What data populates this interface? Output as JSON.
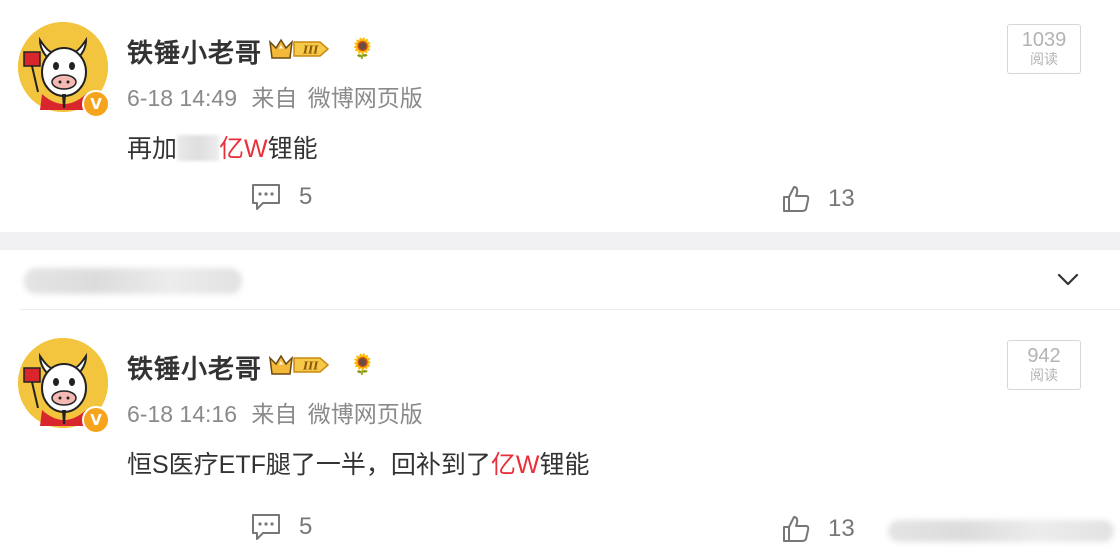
{
  "posts": [
    {
      "username": "铁锤小老哥",
      "date": "6-18 14:49",
      "source_prefix": "来自",
      "source": "微博网页版",
      "content_before": "再加",
      "content_red": "亿W",
      "content_after": "锂能",
      "read_count": "1039",
      "read_label": "阅读",
      "comments": "5",
      "likes": "13"
    },
    {
      "username": "铁锤小老哥",
      "date": "6-18 14:16",
      "source_prefix": "来自",
      "source": "微博网页版",
      "content_before": "恒S医疗ETF腿了一半，回补到了",
      "content_red": "亿W",
      "content_after": "锂能",
      "read_count": "942",
      "read_label": "阅读",
      "comments": "5",
      "likes": "13"
    }
  ],
  "level_badge": "III",
  "verified_badge": "V",
  "colors": {
    "highlight": "#e8303a",
    "badge_orange": "#f7a41d",
    "avatar_yellow": "#f3c53f"
  }
}
